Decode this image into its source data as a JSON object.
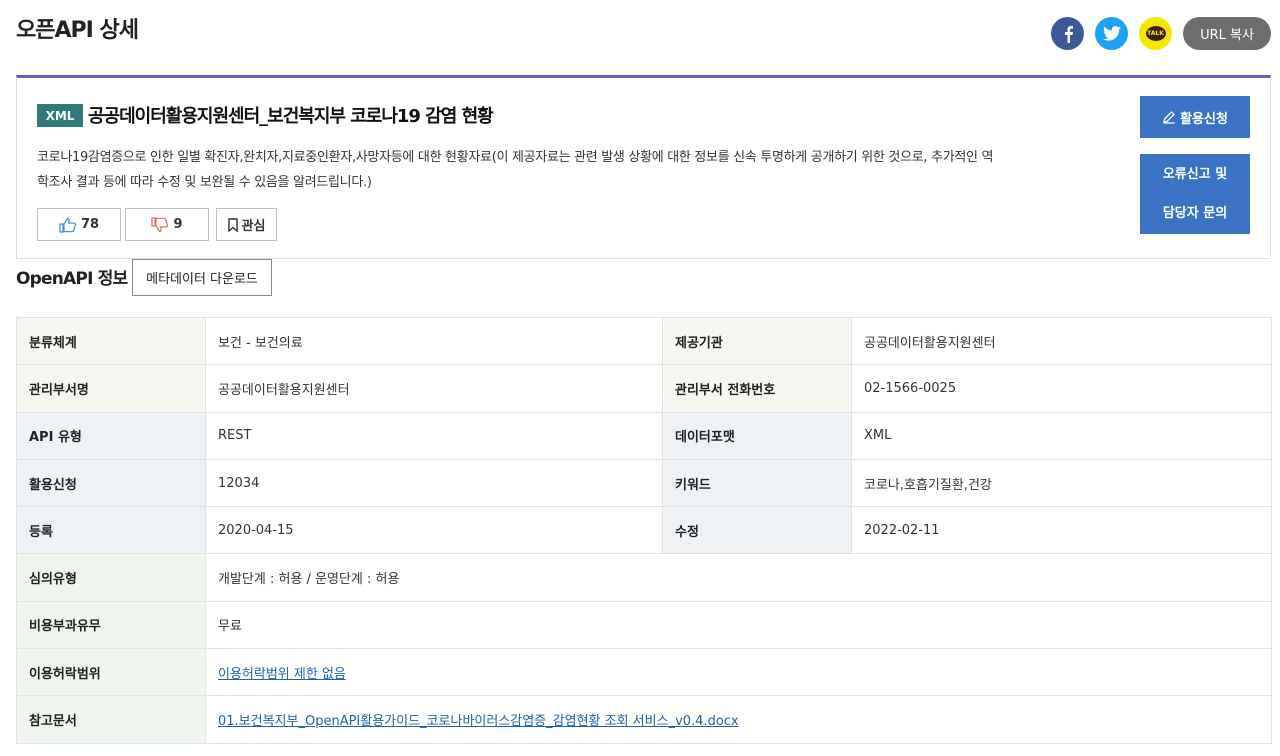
{
  "page": {
    "title": "오픈API 상세"
  },
  "share": {
    "url_copy_label": "URL 복사",
    "kakao_label": "TALK"
  },
  "api": {
    "format_badge": "XML",
    "title": "공공데이터활용지원센터_보건복지부 코로나19 감염 현황",
    "description": "코로나19감염증으로 인한 일별 확진자,완치자,지료중인환자,사망자등에 대한 현황자료(이 제공자료는 관련 발생 상황에 대한 정보를 신속 투명하게 공개하기 위한 것으로, 추가적인 역학조사 결과 등에 따라 수정 및 보완될 수 있음을 알려드립니다.)",
    "likes": "78",
    "dislikes": "9",
    "favorite_label": "관심",
    "apply_label": "활용신청",
    "report_line1": "오류신고 및",
    "report_line2": "담당자 문의"
  },
  "section": {
    "title": "OpenAPI 정보",
    "meta_download_label": "메타데이터 다운로드"
  },
  "info": {
    "category_label": "분류체계",
    "category": "보건 - 보건의료",
    "provider_label": "제공기관",
    "provider": "공공데이터활용지원센터",
    "dept_label": "관리부서명",
    "dept": "공공데이터활용지원센터",
    "phone_label": "관리부서 전화번호",
    "phone": "02-1566-0025",
    "api_type_label": "API 유형",
    "api_type": "REST",
    "data_format_label": "데이터포맷",
    "data_format": "XML",
    "apply_count_label": "활용신청",
    "apply_count": "12034",
    "keywords_label": "키워드",
    "keywords": "코로나,호흡기질환,건강",
    "registered_label": "등록",
    "registered": "2020-04-15",
    "modified_label": "수정",
    "modified": "2022-02-11",
    "review_label": "심의유형",
    "review": "개발단계 : 허용 / 운영단계 : 허용",
    "fee_label": "비용부과유무",
    "fee": "무료",
    "license_label": "이용허락범위",
    "license": "이용허락범위 제한 없음",
    "reference_label": "참고문서",
    "reference": "01.보건복지부_OpenAPI활용가이드_코로나바이러스감염증_감염현황 조회 서비스_v0.4.docx"
  },
  "colors": {
    "accent": "#6a5fc1",
    "badge": "#2f7b7b",
    "button": "#3a73c4",
    "link": "#1f5fb5"
  }
}
